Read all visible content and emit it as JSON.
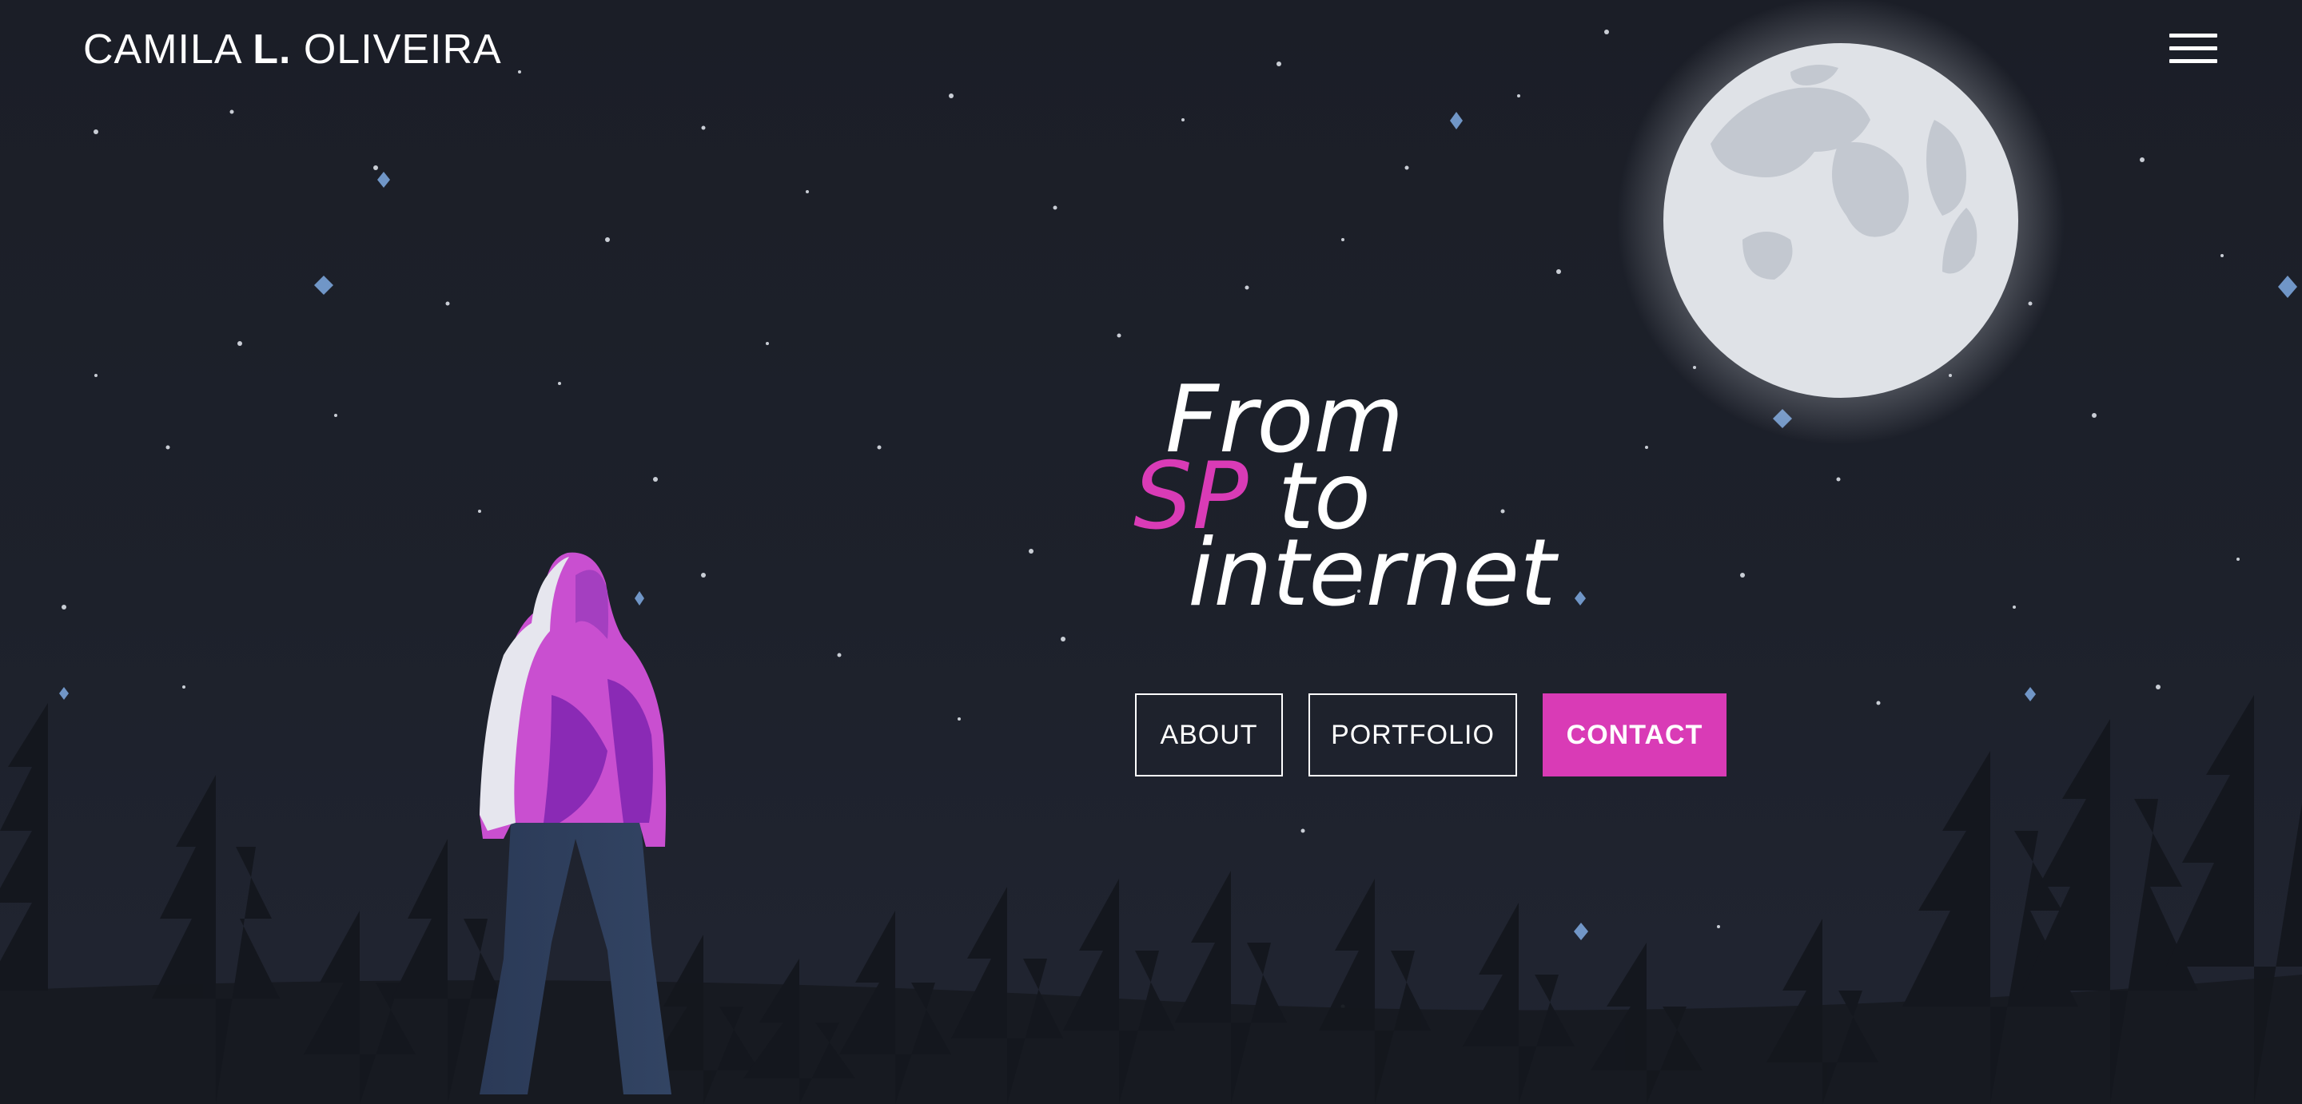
{
  "header": {
    "logo_first": "CAMILA",
    "logo_bold": "L.",
    "logo_last": "OLIVEIRA",
    "menu_icon": "hamburger-menu-icon"
  },
  "hero": {
    "line1": "From",
    "line2_accent": "SP",
    "line2_rest": " to",
    "line3": "internet"
  },
  "nav_buttons": {
    "about": "ABOUT",
    "portfolio": "PORTFOLIO",
    "contact": "CONTACT"
  },
  "colors": {
    "background": "#1c1f29",
    "accent": "#d93bb6",
    "moon": "#dfe2e7",
    "trees": "#14171e"
  }
}
